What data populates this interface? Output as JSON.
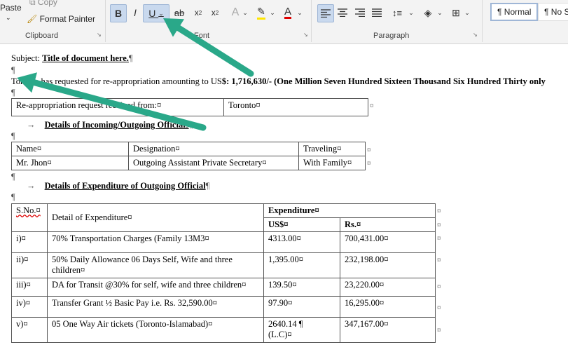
{
  "ribbon": {
    "clipboard": {
      "paste": "Paste",
      "copy": "Copy",
      "format_painter": "Format Painter",
      "label": "Clipboard"
    },
    "font": {
      "label": "Font"
    },
    "paragraph": {
      "label": "Paragraph"
    },
    "styles": {
      "normal": "¶ Normal",
      "no_spacing": "¶ No S"
    }
  },
  "document": {
    "subject_label": "Subject:",
    "subject_title": "Title of document here.",
    "para_mark": "¶",
    "body_start": "Toro",
    "body_hidden": "nto has requested for re-appropriation amounting to US",
    "body_amount": "$: 1,716,630/-",
    "body_words": "(One Million Seven Hundred Sixteen Thousand Six Hundred Thirty only",
    "req_label": "Re-appropriation request received from:¤",
    "req_value": "Toronto¤",
    "incoming_heading": "Details of Incoming/Outgoing Officials",
    "officials": {
      "headers": [
        "Name¤",
        "Designation¤",
        "Traveling¤"
      ],
      "rows": [
        [
          "Mr. Jhon¤",
          "Outgoing Assistant Private Secretary¤",
          "With Family¤"
        ]
      ]
    },
    "expenditure_heading": "Details of Expenditure of Outgoing Official",
    "expenditure": {
      "h_sno": "S.No.¤",
      "h_detail": "Detail of Expenditure¤",
      "h_exp": "Expenditure¤",
      "h_usd": "US$¤",
      "h_rs": "Rs.¤",
      "rows": [
        {
          "sno": "i)¤",
          "detail": "70% Transportation Charges (Family 13M3¤",
          "usd": "4313.00¤",
          "rs": "700,431.00¤"
        },
        {
          "sno": "ii)¤",
          "detail": "50% Daily Allowance 06 Days Self, Wife and three",
          "detail2": "children¤",
          "usd": "1,395.00¤",
          "rs": "232,198.00¤"
        },
        {
          "sno": "iii)¤",
          "detail": "DA for Transit @30% for self, wife and three children¤",
          "usd": "139.50¤",
          "rs": "23,220.00¤"
        },
        {
          "sno": "iv)¤",
          "detail": "Transfer Grant ½ Basic Pay i.e. Rs. 32,590.00¤",
          "usd": "97.90¤",
          "rs": "16,295.00¤"
        },
        {
          "sno": "v)¤",
          "detail": "05 One Way Air tickets (Toronto-Islamabad)¤",
          "usd": "2640.14 ¶",
          "usd2": "(L.C)¤",
          "rs": "347,167.00¤"
        }
      ]
    },
    "cell_end": "¤",
    "arrow_color": "#2aa889"
  }
}
